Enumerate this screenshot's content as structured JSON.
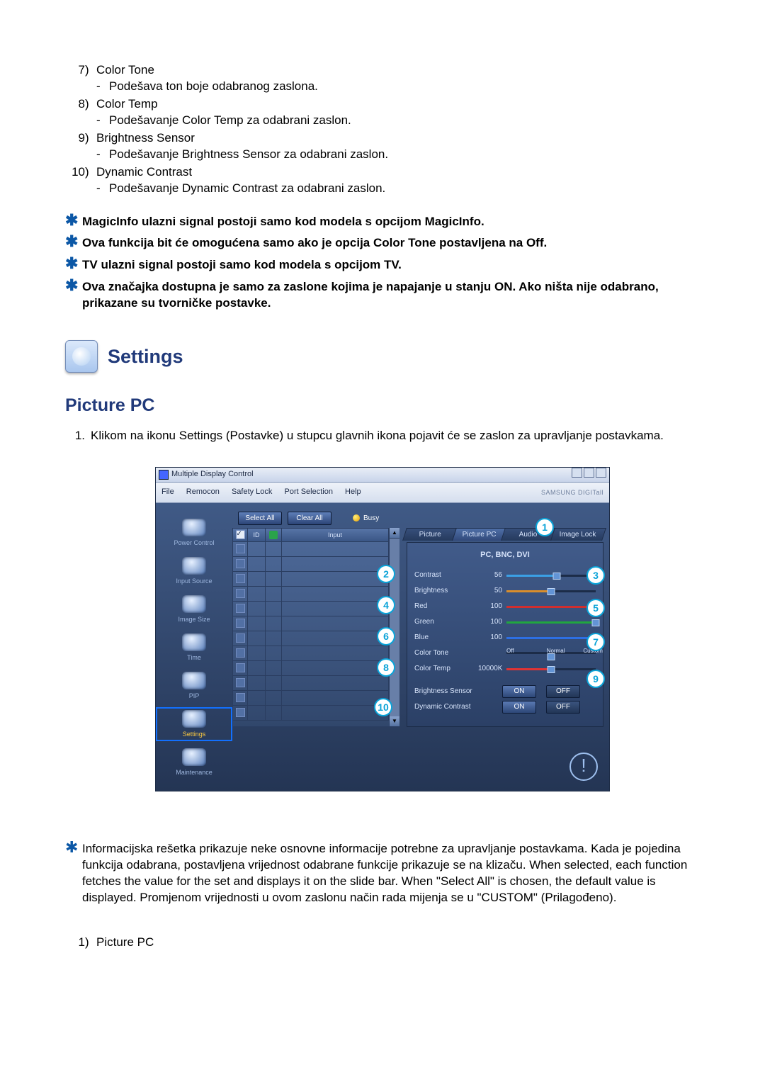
{
  "list1": [
    {
      "n": "7",
      "t": "Color Tone",
      "d": "Podešava ton boje odabranog zaslona."
    },
    {
      "n": "8",
      "t": "Color Temp",
      "d": "Podešavanje Color Temp za odabrani zaslon."
    },
    {
      "n": "9",
      "t": "Brightness Sensor",
      "d": "Podešavanje Brightness Sensor za odabrani zaslon."
    },
    {
      "n": "10",
      "t": "Dynamic Contrast",
      "d": "Podešavanje Dynamic Contrast za odabrani zaslon."
    }
  ],
  "notes": [
    "MagicInfo ulazni signal postoji samo kod modela s opcijom MagicInfo.",
    "Ova funkcija bit će omogućena samo ako je opcija Color Tone postavljena na Off.",
    "TV ulazni signal postoji samo kod modela s opcijom TV.",
    "Ova značajka dostupna je samo za zaslone kojima je napajanje u stanju ON. Ako ništa nije odabrano, prikazane su tvorničke postavke."
  ],
  "h_settings": "Settings",
  "h_sub": "Picture PC",
  "intro_n": "1.",
  "intro": "Klikom na ikonu Settings (Postavke) u stupcu glavnih ikona pojavit će se zaslon za upravljanje postavkama.",
  "mdc": {
    "title": "Multiple Display Control",
    "menu": [
      "File",
      "Remocon",
      "Safety Lock",
      "Port Selection",
      "Help"
    ],
    "brand": "SAMSUNG DIGITall",
    "side": [
      "Power Control",
      "Input Source",
      "Image Size",
      "Time",
      "PIP",
      "Settings",
      "Maintenance"
    ],
    "side_sel": 5,
    "select_all": "Select All",
    "clear_all": "Clear All",
    "busy": "Busy",
    "grid_head": {
      "chk": "☑",
      "id": "ID",
      "st": "",
      "input": "Input"
    },
    "tabs": [
      "Picture",
      "Picture PC",
      "Audio",
      "Image Lock"
    ],
    "tab_sel": 1,
    "panel_hdr": "PC, BNC, DVI",
    "rows": {
      "contrast": {
        "l": "Contrast",
        "v": "56",
        "p": 56,
        "cls": "brt"
      },
      "brightness": {
        "l": "Brightness",
        "v": "50",
        "p": 50,
        "cls": "br"
      },
      "red": {
        "l": "Red",
        "v": "100",
        "p": 100,
        "cls": "red"
      },
      "green": {
        "l": "Green",
        "v": "100",
        "p": 100,
        "cls": "grn"
      },
      "blue": {
        "l": "Blue",
        "v": "100",
        "p": 100,
        "cls": "blu"
      },
      "colortone": {
        "l": "Color Tone",
        "opts": [
          "Off",
          "Normal",
          "Custom"
        ],
        "sel": 1
      },
      "colortemp": {
        "l": "Color Temp",
        "v": "10000K",
        "p": 50,
        "cls": "ct"
      },
      "bsensor": {
        "l": "Brightness Sensor",
        "on": "ON",
        "off": "OFF"
      },
      "dcontrast": {
        "l": "Dynamic Contrast",
        "on": "ON",
        "off": "OFF"
      }
    }
  },
  "note2": "Informacijska rešetka prikazuje neke osnovne informacije potrebne za upravljanje postavkama. Kada je pojedina funkcija odabrana, postavljena vrijednost odabrane funkcije prikazuje se na klizaču. When selected, each function fetches the value for the set and displays it on the slide bar. When \"Select All\" is chosen, the default value is displayed. Promjenom vrijednosti u ovom zaslonu način rada mijenja se u \"CUSTOM\" (Prilagođeno).",
  "list2": [
    {
      "n": "1",
      "t": "Picture PC"
    }
  ]
}
